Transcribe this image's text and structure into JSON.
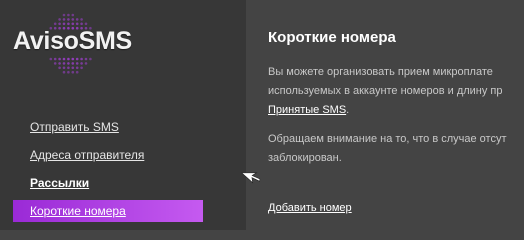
{
  "logo": {
    "text": "AvisoSMS"
  },
  "sidebar": {
    "items": [
      {
        "label": "Отправить SMS"
      },
      {
        "label": "Адреса отправителя"
      },
      {
        "label": "Рассылки"
      },
      {
        "label": "Короткие номера"
      }
    ]
  },
  "main": {
    "title": "Короткие номера",
    "para1_line1": "Вы можете организовать прием микроплате",
    "para1_line2": "используемых в аккаунте номеров и длину пр",
    "para1_link": "Принятые SMS",
    "para1_tail": ".",
    "para2_line1": "Обращаем внимание на то, что в случае отсут",
    "para2_line2": "заблокирован.",
    "add_link": "Добавить номер"
  },
  "colors": {
    "accent": "#b040e8",
    "sidebar_bg": "#373737",
    "main_bg": "#444444"
  }
}
